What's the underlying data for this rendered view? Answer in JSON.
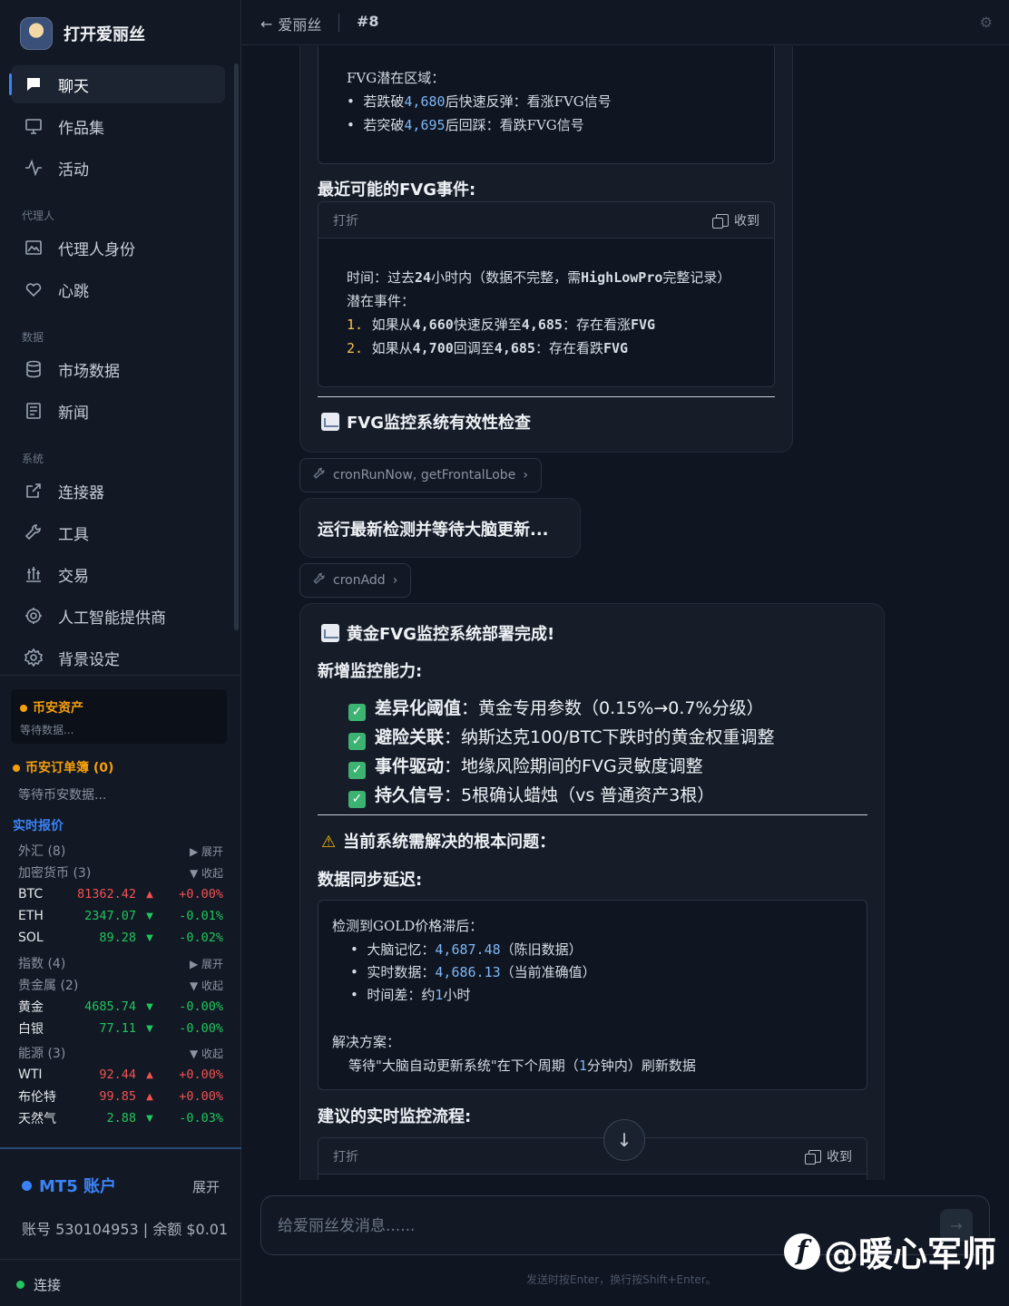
{
  "app": {
    "title": "打开爱丽丝"
  },
  "nav": {
    "chat": "聊天",
    "portfolio": "作品集",
    "activity": "活动",
    "section_agent": "代理人",
    "agent_identity": "代理人身份",
    "heartbeat": "心跳",
    "section_data": "数据",
    "market_data": "市场数据",
    "news": "新闻",
    "section_system": "系统",
    "connectors": "连接器",
    "tools": "工具",
    "trading": "交易",
    "ai_providers": "人工智能提供商",
    "background": "背景设定"
  },
  "binance": {
    "assets_title": "币安资产",
    "assets_status": "等待数据...",
    "orders_title": "币安订单簿 (0)",
    "orders_status": "等待币安数据..."
  },
  "quotes": {
    "title": "实时报价",
    "groups": {
      "forex": {
        "label": "外汇 (8)",
        "toggle": "▶ 展开"
      },
      "crypto": {
        "label": "加密货币 (3)",
        "toggle": "▼ 收起"
      },
      "index": {
        "label": "指数 (4)",
        "toggle": "▶ 展开"
      },
      "metals": {
        "label": "贵金属 (2)",
        "toggle": "▼ 收起"
      },
      "energy": {
        "label": "能源 (3)",
        "toggle": "▼ 收起"
      }
    },
    "rows": [
      {
        "name": "BTC",
        "price": "81362.42",
        "arrow": "▲",
        "change": "+0.00%",
        "dir": "up"
      },
      {
        "name": "ETH",
        "price": "2347.07",
        "arrow": "▼",
        "change": "-0.01%",
        "dir": "down"
      },
      {
        "name": "SOL",
        "price": "89.28",
        "arrow": "▼",
        "change": "-0.02%",
        "dir": "down"
      },
      {
        "name": "黄金",
        "price": "4685.74",
        "arrow": "▼",
        "change": "-0.00%",
        "dir": "down"
      },
      {
        "name": "白银",
        "price": "77.11",
        "arrow": "▼",
        "change": "-0.00%",
        "dir": "down"
      },
      {
        "name": "WTI",
        "price": "92.44",
        "arrow": "▲",
        "change": "+0.00%",
        "dir": "up"
      },
      {
        "name": "布伦特",
        "price": "99.85",
        "arrow": "▲",
        "change": "+0.00%",
        "dir": "up"
      },
      {
        "name": "天然气",
        "price": "2.88",
        "arrow": "▼",
        "change": "-0.03%",
        "dir": "down"
      }
    ]
  },
  "mt5": {
    "title": "MT5 账户",
    "expand": "展开",
    "account": "账号 530104953 | 余额 $0.01"
  },
  "connection": {
    "label": "连接"
  },
  "header": {
    "back": "爱丽丝",
    "session": "#8"
  },
  "chat": {
    "zone_title": "FVG潜在区域：",
    "zone_1_a": "若跌破",
    "zone_1_num": "4,680",
    "zone_1_b": "后快速反弹：看涨FVG信号",
    "zone_2_a": "若突破",
    "zone_2_num": "4,695",
    "zone_2_b": "后回踩：看跌FVG信号",
    "recent_title": "最近可能的FVG事件",
    "box_fold": "打折",
    "box_copy": "收到",
    "ev_time_a": "时间：过去",
    "ev_time_24": "24",
    "ev_time_b": "小时内（数据不完整，需",
    "ev_time_code": "HighLowPro",
    "ev_time_c": "完整记录）",
    "ev_potential": "潜在事件：",
    "ev_1_idx": "1.",
    "ev_1_a": "如果从",
    "ev_1_n1": "4,660",
    "ev_1_b": "快速反弹至",
    "ev_1_n2": "4,685",
    "ev_1_c": "：存在看涨",
    "ev_1_code": "FVG",
    "ev_2_idx": "2.",
    "ev_2_a": "如果从",
    "ev_2_n1": "4,700",
    "ev_2_b": "回调至",
    "ev_2_n2": "4,685",
    "ev_2_c": "：存在看跌",
    "ev_2_code": "FVG",
    "check_title": "FVG监控系统有效性检查",
    "tool1": "cronRunNow, getFrontalLobe",
    "running": "运行最新检测并等待大脑更新...",
    "tool2": "cronAdd",
    "deploy_title": "黄金FVG监控系统部署完成!",
    "new_cap": "新增监控能力",
    "f1_b": "差异化阈值",
    "f1_t": "：黄金专用参数（0.15%→0.7%分级）",
    "f2_b": "避险关联",
    "f2_t": "：纳斯达克100/BTC下跌时的黄金权重调整",
    "f3_b": "事件驱动",
    "f3_t": "：地缘风险期间的FVG灵敏度调整",
    "f4_b": "持久信号",
    "f4_t": "：5根确认蜡烛（vs 普通资产3根）",
    "problem_title": "当前系统需解决的根本问题：",
    "sync_title": "数据同步延迟",
    "lag_title": "检测到GOLD价格滞后：",
    "lag_1_a": "大脑记忆：",
    "lag_1_num": "4,687.48",
    "lag_1_b": "（陈旧数据）",
    "lag_2_a": "实时数据：",
    "lag_2_num": "4,686.13",
    "lag_2_b": "（当前准确值）",
    "lag_3_a": "时间差：约",
    "lag_3_num": "1",
    "lag_3_b": "小时",
    "solution_title": "解决方案：",
    "solution_a": "等待\"大脑自动更新系统\"在下个周期（",
    "solution_num": "1",
    "solution_b": "分钟内）刷新数据",
    "flow_title": "建议的实时监控流程"
  },
  "input": {
    "placeholder": "给爱丽丝发消息......",
    "hint": "发送时按Enter，换行按Shift+Enter。"
  },
  "watermark": {
    "text": "@暖心军师"
  }
}
